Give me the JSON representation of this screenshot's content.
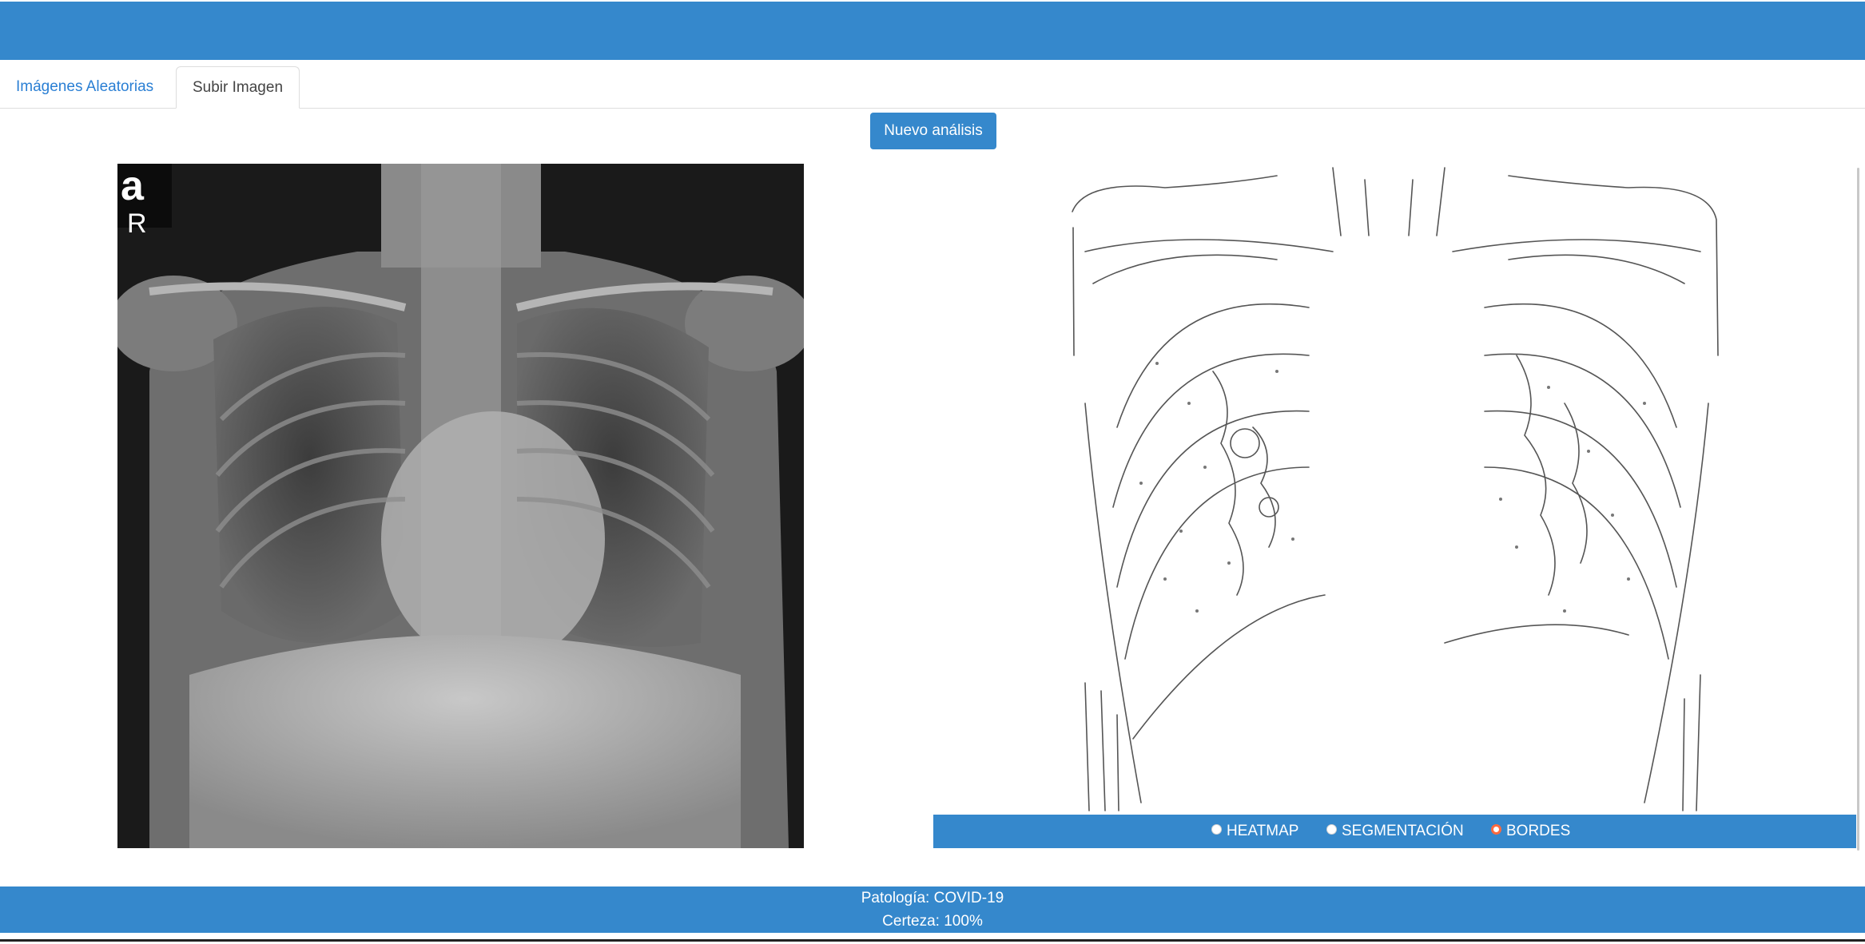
{
  "tabs": [
    {
      "label": "Imágenes Aleatorias",
      "active": false
    },
    {
      "label": "Subir Imagen",
      "active": true
    }
  ],
  "actions": {
    "new_analysis_label": "Nuevo análisis"
  },
  "xray": {
    "corner_letter": "a",
    "side_marker": "R"
  },
  "view_modes": [
    {
      "label": "HEATMAP",
      "selected": false
    },
    {
      "label": "SEGMENTACIÓN",
      "selected": false
    },
    {
      "label": "BORDES",
      "selected": true
    }
  ],
  "result": {
    "pathology": "Patología: COVID-19",
    "certainty": "Certeza: 100%"
  },
  "colors": {
    "primary": "#3588cc",
    "link": "#2a7fd4",
    "radio_selected": "#ff6a3d"
  }
}
